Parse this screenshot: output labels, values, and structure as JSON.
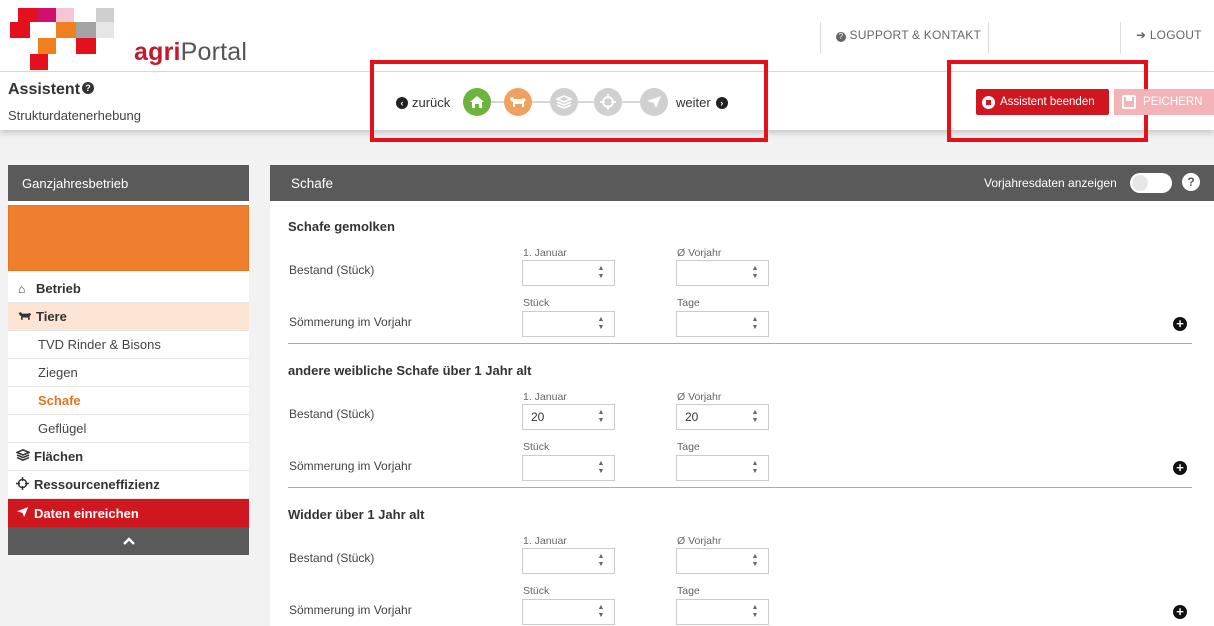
{
  "header": {
    "logo_prefix": "agri",
    "logo_suffix": "Portal",
    "support_label": "SUPPORT & KONTAKT",
    "logout_label": "LOGOUT"
  },
  "assistant": {
    "title": "Assistent",
    "help_glyph": "?",
    "subtitle": "Strukturdatenerhebung",
    "prev_label": "zurück",
    "next_label": "weiter",
    "steps": [
      {
        "icon": "home-icon",
        "state": "done",
        "color": "#6db33f"
      },
      {
        "icon": "cow-icon",
        "state": "current",
        "color": "#f0a160"
      },
      {
        "icon": "layers-icon",
        "state": "pending",
        "color": "#d0d0d0"
      },
      {
        "icon": "crosshair-icon",
        "state": "pending",
        "color": "#d0d0d0"
      },
      {
        "icon": "send-icon",
        "state": "pending",
        "color": "#d0d0d0"
      }
    ],
    "end_label": "Assistent beenden",
    "save_label": "PEICHERN"
  },
  "sidebar": {
    "header": "Ganzjahresbetrieb",
    "items": [
      {
        "label": "Betrieb",
        "icon": "home-icon",
        "level": 1
      },
      {
        "label": "Tiere",
        "icon": "cow-icon",
        "level": 1
      },
      {
        "label": "TVD Rinder & Bisons",
        "level": 2
      },
      {
        "label": "Ziegen",
        "level": 2
      },
      {
        "label": "Schafe",
        "level": 2
      },
      {
        "label": "Geflügel",
        "level": 2
      },
      {
        "label": "Flächen",
        "icon": "layers-icon",
        "level": 1
      },
      {
        "label": "Ressourceneffizienz",
        "icon": "crosshair-icon",
        "level": 1
      },
      {
        "label": "Daten einreichen",
        "icon": "send-icon",
        "level": 1
      }
    ]
  },
  "main": {
    "title": "Schafe",
    "prev_year_toggle_label": "Vorjahresdaten anzeigen",
    "prev_year_toggle_on": false,
    "help_glyph": "?",
    "sections": [
      {
        "title": "Schafe gemolken",
        "stock_label": "Bestand (Stück)",
        "col1": "1. Januar",
        "col2": "Ø Vorjahr",
        "stock_jan": "",
        "stock_prev": "",
        "summer_label": "Sömmerung im Vorjahr",
        "col3": "Stück",
        "col4": "Tage",
        "summer_count": "",
        "summer_days": ""
      },
      {
        "title": "andere weibliche Schafe über 1 Jahr alt",
        "stock_label": "Bestand (Stück)",
        "col1": "1. Januar",
        "col2": "Ø Vorjahr",
        "stock_jan": "20",
        "stock_prev": "20",
        "summer_label": "Sömmerung im Vorjahr",
        "col3": "Stück",
        "col4": "Tage",
        "summer_count": "",
        "summer_days": ""
      },
      {
        "title": "Widder über 1 Jahr alt",
        "stock_label": "Bestand (Stück)",
        "col1": "1. Januar",
        "col2": "Ø Vorjahr",
        "stock_jan": "",
        "stock_prev": "",
        "summer_label": "Sömmerung im Vorjahr",
        "col3": "Stück",
        "col4": "Tage",
        "summer_count": "",
        "summer_days": ""
      }
    ]
  }
}
